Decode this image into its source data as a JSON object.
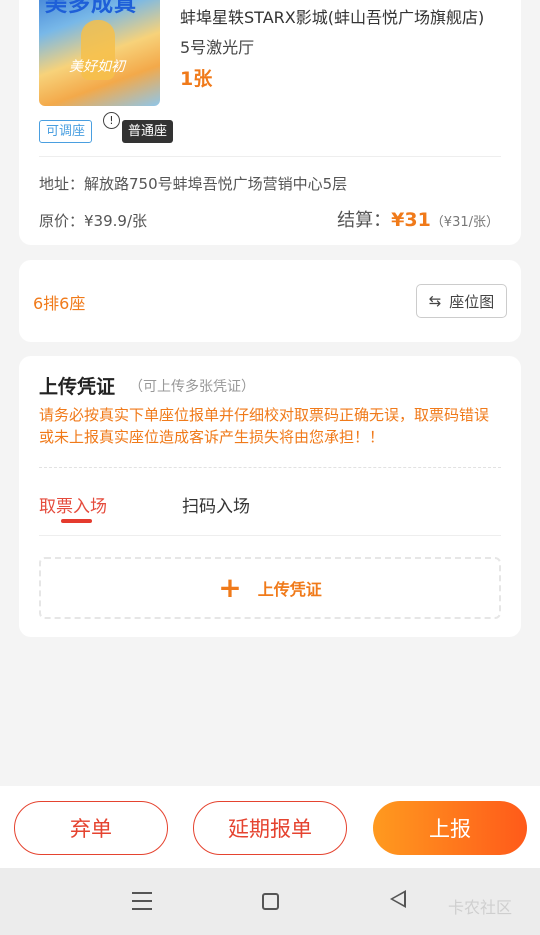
{
  "order": {
    "poster_title": "美多成真",
    "poster_script": "美好如初",
    "cinema": "蚌埠星轶STARX影城(蚌山吾悦广场旗舰店)",
    "hall": "5号激光厅",
    "quantity": "1张",
    "tag_adjustable": "可调座",
    "info_icon": "!",
    "tag_normal": "普通座",
    "address": "地址：解放路750号蚌埠吾悦广场营销中心5层",
    "original_price": "原价：¥39.9/张",
    "settle_label": "结算：",
    "settle_amount": "¥31",
    "settle_unit": "（¥31/张）"
  },
  "seat": {
    "text": "6排6座",
    "map_icon": "⇆",
    "map_label": "座位图"
  },
  "upload": {
    "title": "上传凭证",
    "hint": "（可上传多张凭证）",
    "warning": "请务必按真实下单座位报单并仔细校对取票码正确无误，取票码错误或未上报真实座位造成客诉产生损失将由您承担！！",
    "tabs": [
      {
        "label": "取票入场",
        "active": true
      },
      {
        "label": "扫码入场",
        "active": false
      }
    ],
    "upload_plus": "+",
    "upload_label": "上传凭证"
  },
  "actions": {
    "abandon": "弃单",
    "postpone": "延期报单",
    "submit": "上报"
  },
  "system": {
    "watermark": "卡农社区"
  },
  "colors": {
    "accent": "#f07a1a",
    "danger": "#e5432f",
    "tag_blue": "#4a9fe0"
  }
}
